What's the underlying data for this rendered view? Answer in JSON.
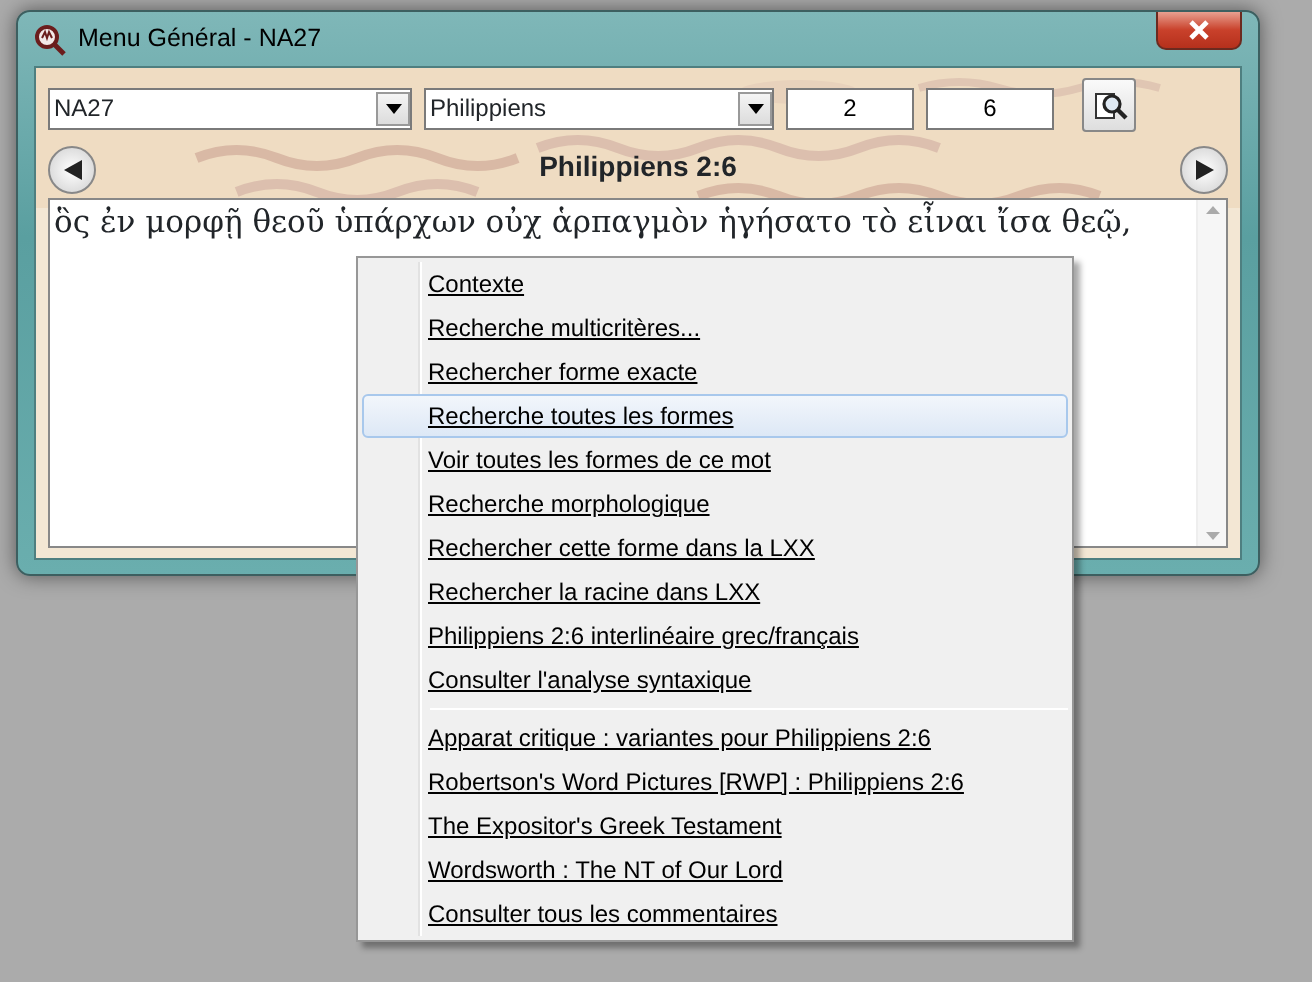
{
  "window": {
    "title": "Menu Général - NA27"
  },
  "toolbar": {
    "version": "NA27",
    "book": "Philippiens",
    "chapter": "2",
    "verse": "6"
  },
  "heading": "Philippiens 2:6",
  "verse_text": "ὃς ἐν μορφῇ θεοῦ ὑπάρχων οὐχ ἁρπαγμὸν ἡγήσατο τὸ εἶναι ἴσα θεῷ,",
  "context_menu": {
    "items": [
      {
        "kind": "item",
        "label": "Contexte",
        "selected": false
      },
      {
        "kind": "item",
        "label": "Recherche multicritères...",
        "selected": false
      },
      {
        "kind": "item",
        "label": "Rechercher forme exacte",
        "selected": false
      },
      {
        "kind": "item",
        "label": "Recherche toutes les formes",
        "selected": true
      },
      {
        "kind": "item",
        "label": "Voir toutes les formes de ce mot",
        "selected": false
      },
      {
        "kind": "item",
        "label": "Recherche morphologique",
        "selected": false
      },
      {
        "kind": "item",
        "label": "Rechercher cette forme dans la LXX",
        "selected": false
      },
      {
        "kind": "item",
        "label": "Rechercher la racine dans LXX",
        "selected": false
      },
      {
        "kind": "item",
        "label": "Philippiens 2:6 interlinéaire grec/français",
        "selected": false
      },
      {
        "kind": "item",
        "label": "Consulter l'analyse syntaxique",
        "selected": false
      },
      {
        "kind": "separator"
      },
      {
        "kind": "item",
        "label": "Apparat critique : variantes pour Philippiens 2:6",
        "selected": false
      },
      {
        "kind": "item",
        "label": "Robertson's Word Pictures [RWP] : Philippiens 2:6",
        "selected": false
      },
      {
        "kind": "item",
        "label": "The Expositor's Greek Testament",
        "selected": false
      },
      {
        "kind": "item",
        "label": "Wordsworth : The NT of Our Lord",
        "selected": false
      },
      {
        "kind": "item",
        "label": "Consulter tous les commentaires",
        "selected": false
      }
    ]
  }
}
